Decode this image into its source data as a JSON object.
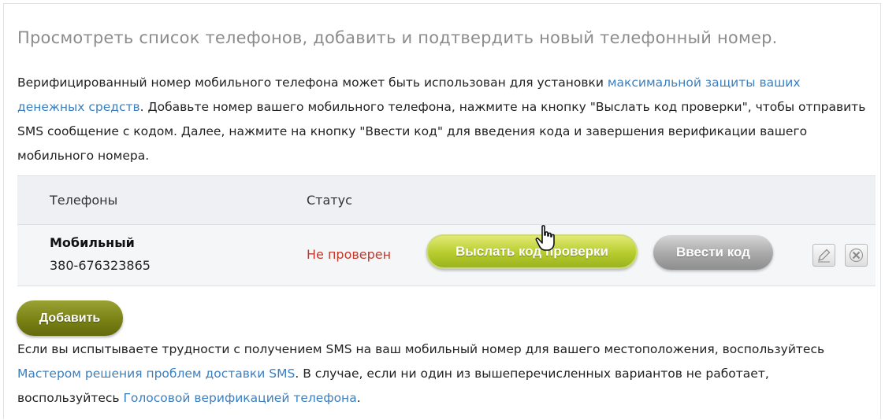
{
  "page": {
    "title": "Просмотреть список телефонов, добавить и подтвердить новый телефонный номер."
  },
  "intro": {
    "text1": "Верифицированный номер мобильного телефона может быть использован для установки ",
    "link1": "максимальной защиты ваших денежных средств",
    "text2": ". Добавьте номер вашего мобильного телефона, нажмите на кнопку \"Выслать код проверки\", чтобы отправить SMS сообщение с кодом. Далее, нажмите на кнопку \"Ввести код\" для введения кода и завершения верификации вашего мобильного номера."
  },
  "table": {
    "columns": {
      "phones": "Телефоны",
      "status": "Статус"
    },
    "rows": [
      {
        "type": "Мобильный",
        "number": "380-676323865",
        "status": "Не проверен",
        "send_code_label": "Выслать код проверки",
        "enter_code_label": "Ввести код",
        "edit_icon": "pencil-icon",
        "delete_icon": "close-icon"
      }
    ]
  },
  "actions": {
    "add_label": "Добавить"
  },
  "help": {
    "text1": "Если вы испытываете трудности с получением SMS на ваш мобильный номер для вашего местоположения, воспользуйтесь ",
    "link1": "Мастером решения проблем доставки SMS",
    "text2": ". В случае, если ни один из вышеперечисленных вариантов не работает, воспользуйтесь ",
    "link2": "Голосовой верификацией телефона",
    "text3": "."
  },
  "colors": {
    "link": "#3b7fc0",
    "status_unverified": "#c0392b",
    "primary_button": "#b6cc2c",
    "secondary_button": "#a8a8a8",
    "add_button": "#7a8215"
  }
}
